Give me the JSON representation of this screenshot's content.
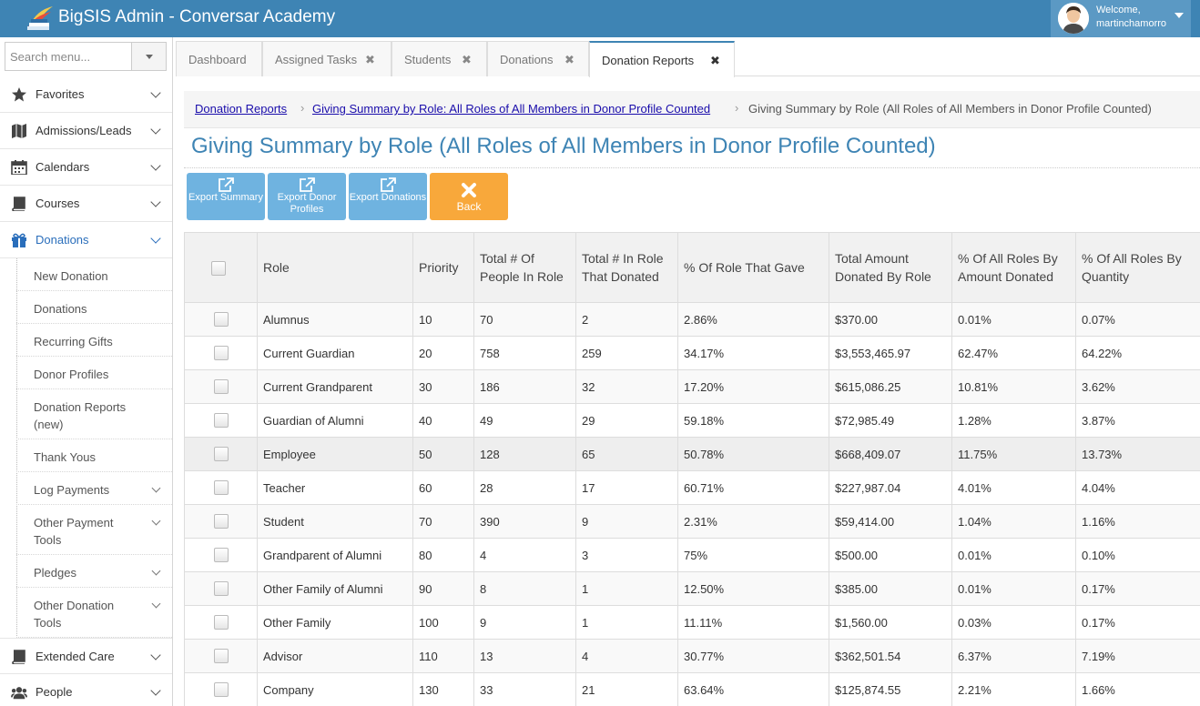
{
  "app": {
    "title": "BigSIS Admin - Conversar Academy"
  },
  "user": {
    "welcome": "Welcome,",
    "name": "martinchamorro"
  },
  "search": {
    "placeholder": "Search menu..."
  },
  "sidebar": {
    "items": [
      {
        "label": "Favorites",
        "icon": "star-icon"
      },
      {
        "label": "Admissions/Leads",
        "icon": "map-icon"
      },
      {
        "label": "Calendars",
        "icon": "calendar-icon"
      },
      {
        "label": "Courses",
        "icon": "book-icon"
      },
      {
        "label": "Donations",
        "icon": "gift-icon",
        "active": true
      },
      {
        "label": "Extended Care",
        "icon": "book-icon"
      },
      {
        "label": "People",
        "icon": "people-icon"
      }
    ],
    "donation_sub": [
      {
        "label": "New Donation"
      },
      {
        "label": "Donations"
      },
      {
        "label": "Recurring Gifts"
      },
      {
        "label": "Donor Profiles"
      },
      {
        "label": "Donation Reports (new)"
      },
      {
        "label": "Thank Yous"
      },
      {
        "label": "Log Payments"
      },
      {
        "label": "Other Payment Tools"
      },
      {
        "label": "Pledges"
      },
      {
        "label": "Other Donation Tools"
      }
    ]
  },
  "tabs": [
    {
      "label": "Dashboard"
    },
    {
      "label": "Assigned Tasks"
    },
    {
      "label": "Students"
    },
    {
      "label": "Donations"
    },
    {
      "label": "Donation Reports",
      "active": true
    }
  ],
  "tab_close_glyph": "✖",
  "breadcrumb": {
    "crumb1": "Donation Reports",
    "crumb2": "Giving Summary by Role: All Roles of All Members in Donor Profile Counted",
    "current": "Giving Summary by Role (All Roles of All Members in Donor Profile Counted)",
    "sep": "›"
  },
  "page": {
    "title": "Giving Summary by Role (All Roles of All Members in Donor Profile Counted)"
  },
  "actions": {
    "export_summary": "Export Summary",
    "export_donor_profiles": "Export Donor Profiles",
    "export_donations": "Export Donations",
    "back": "Back"
  },
  "colors": {
    "topbar": "#3e84b4",
    "accent": "#3e84b4",
    "action_blue": "#6fb3e0",
    "action_orange": "#f8a83b"
  },
  "table": {
    "headers": {
      "role": "Role",
      "priority": "Priority",
      "total_people": "Total # Of People In Role",
      "total_donated": "Total # In Role That Donated",
      "pct_gave": "% Of Role That Gave",
      "total_amount": "Total Amount Donated By Role",
      "pct_amount": "% Of All Roles By Amount Donated",
      "pct_quantity": "% Of All Roles By Quantity"
    },
    "rows": [
      {
        "role": "Alumnus",
        "priority": "10",
        "total_people": "70",
        "total_donated": "2",
        "pct_gave": "2.86%",
        "total_amount": "$370.00",
        "pct_amount": "0.01%",
        "pct_quantity": "0.07%"
      },
      {
        "role": "Current Guardian",
        "priority": "20",
        "total_people": "758",
        "total_donated": "259",
        "pct_gave": "34.17%",
        "total_amount": "$3,553,465.97",
        "pct_amount": "62.47%",
        "pct_quantity": "64.22%"
      },
      {
        "role": "Current Grandparent",
        "priority": "30",
        "total_people": "186",
        "total_donated": "32",
        "pct_gave": "17.20%",
        "total_amount": "$615,086.25",
        "pct_amount": "10.81%",
        "pct_quantity": "3.62%"
      },
      {
        "role": "Guardian of Alumni",
        "priority": "40",
        "total_people": "49",
        "total_donated": "29",
        "pct_gave": "59.18%",
        "total_amount": "$72,985.49",
        "pct_amount": "1.28%",
        "pct_quantity": "3.87%"
      },
      {
        "role": "Employee",
        "priority": "50",
        "total_people": "128",
        "total_donated": "65",
        "pct_gave": "50.78%",
        "total_amount": "$668,409.07",
        "pct_amount": "11.75%",
        "pct_quantity": "13.73%"
      },
      {
        "role": "Teacher",
        "priority": "60",
        "total_people": "28",
        "total_donated": "17",
        "pct_gave": "60.71%",
        "total_amount": "$227,987.04",
        "pct_amount": "4.01%",
        "pct_quantity": "4.04%"
      },
      {
        "role": "Student",
        "priority": "70",
        "total_people": "390",
        "total_donated": "9",
        "pct_gave": "2.31%",
        "total_amount": "$59,414.00",
        "pct_amount": "1.04%",
        "pct_quantity": "1.16%"
      },
      {
        "role": "Grandparent of Alumni",
        "priority": "80",
        "total_people": "4",
        "total_donated": "3",
        "pct_gave": "75%",
        "total_amount": "$500.00",
        "pct_amount": "0.01%",
        "pct_quantity": "0.10%"
      },
      {
        "role": "Other Family of Alumni",
        "priority": "90",
        "total_people": "8",
        "total_donated": "1",
        "pct_gave": "12.50%",
        "total_amount": "$385.00",
        "pct_amount": "0.01%",
        "pct_quantity": "0.17%"
      },
      {
        "role": "Other Family",
        "priority": "100",
        "total_people": "9",
        "total_donated": "1",
        "pct_gave": "11.11%",
        "total_amount": "$1,560.00",
        "pct_amount": "0.03%",
        "pct_quantity": "0.17%"
      },
      {
        "role": "Advisor",
        "priority": "110",
        "total_people": "13",
        "total_donated": "4",
        "pct_gave": "30.77%",
        "total_amount": "$362,501.54",
        "pct_amount": "6.37%",
        "pct_quantity": "7.19%"
      },
      {
        "role": "Company",
        "priority": "130",
        "total_people": "33",
        "total_donated": "21",
        "pct_gave": "63.64%",
        "total_amount": "$125,874.55",
        "pct_amount": "2.21%",
        "pct_quantity": "1.66%"
      }
    ]
  }
}
